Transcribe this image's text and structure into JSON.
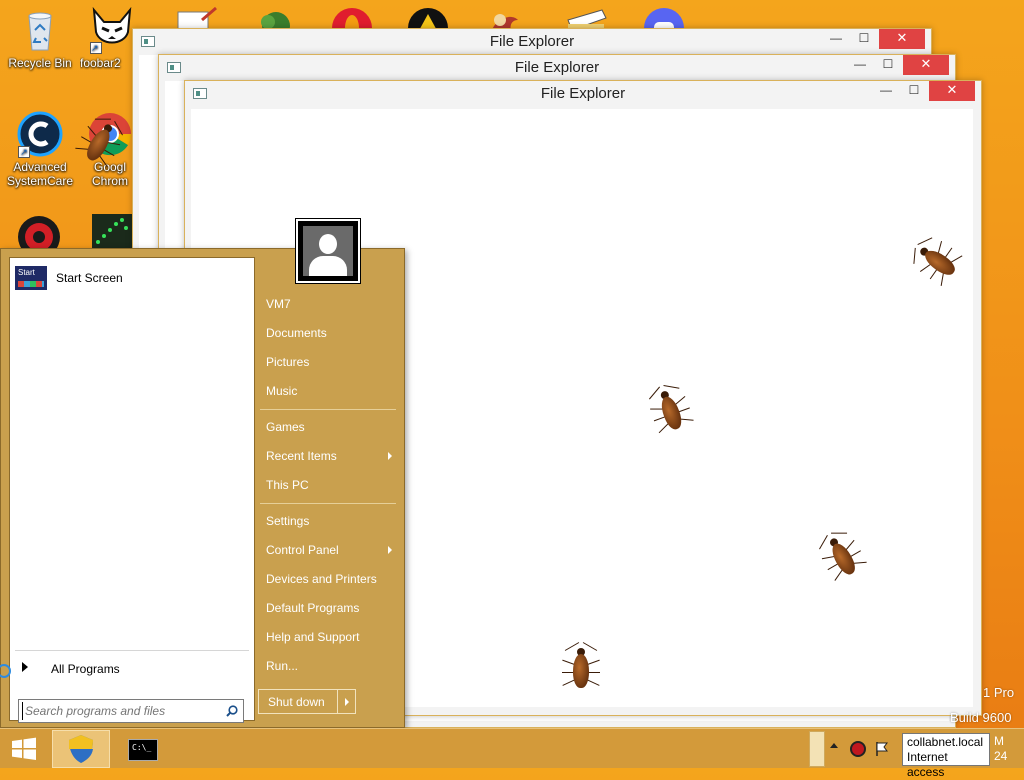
{
  "desktop": {
    "icons": [
      {
        "label": "Recycle Bin"
      },
      {
        "label": "foobar2"
      },
      {
        "label": "Advanced SystemCare"
      },
      {
        "label": "Googl Chrom"
      }
    ]
  },
  "windows": [
    {
      "title": "File Explorer",
      "minimize": "—",
      "maximize": "☐",
      "close": "✕"
    },
    {
      "title": "File Explorer",
      "minimize": "—",
      "maximize": "☐",
      "close": "✕"
    },
    {
      "title": "File Explorer",
      "minimize": "—",
      "maximize": "☐",
      "close": "✕"
    }
  ],
  "start_menu": {
    "pinned": [
      {
        "label": "Start Screen",
        "icon_text": "Start"
      }
    ],
    "all_programs": "All Programs",
    "search": {
      "placeholder": "Search programs and files",
      "value": ""
    },
    "right_items": [
      {
        "label": "VM7",
        "has_submenu": false
      },
      {
        "label": "Documents",
        "has_submenu": false
      },
      {
        "label": "Pictures",
        "has_submenu": false
      },
      {
        "label": "Music",
        "has_submenu": false
      },
      {
        "label": "Games",
        "has_submenu": false
      },
      {
        "label": "Recent Items",
        "has_submenu": true
      },
      {
        "label": "This PC",
        "has_submenu": false
      },
      {
        "label": "Settings",
        "has_submenu": false
      },
      {
        "label": "Control Panel",
        "has_submenu": true
      },
      {
        "label": "Devices and Printers",
        "has_submenu": false
      },
      {
        "label": "Default Programs",
        "has_submenu": false
      },
      {
        "label": "Help and Support",
        "has_submenu": false
      },
      {
        "label": "Run...",
        "has_submenu": false
      }
    ],
    "shutdown": {
      "label": "Shut down",
      "arrow": "▸"
    }
  },
  "taskbar": {
    "tray_tooltip": {
      "line1": "collabnet.local",
      "line2": "Internet access"
    },
    "clock_partial": {
      "time": "M",
      "date": "24"
    }
  },
  "watermark": {
    "line1": "1 Pro",
    "line2": "Build 9600"
  },
  "colors": {
    "start_menu_bg": "#c9a04e",
    "taskbar_bg": "#d39a3a",
    "close_button": "#e04343",
    "desktop": "#f39c12"
  }
}
